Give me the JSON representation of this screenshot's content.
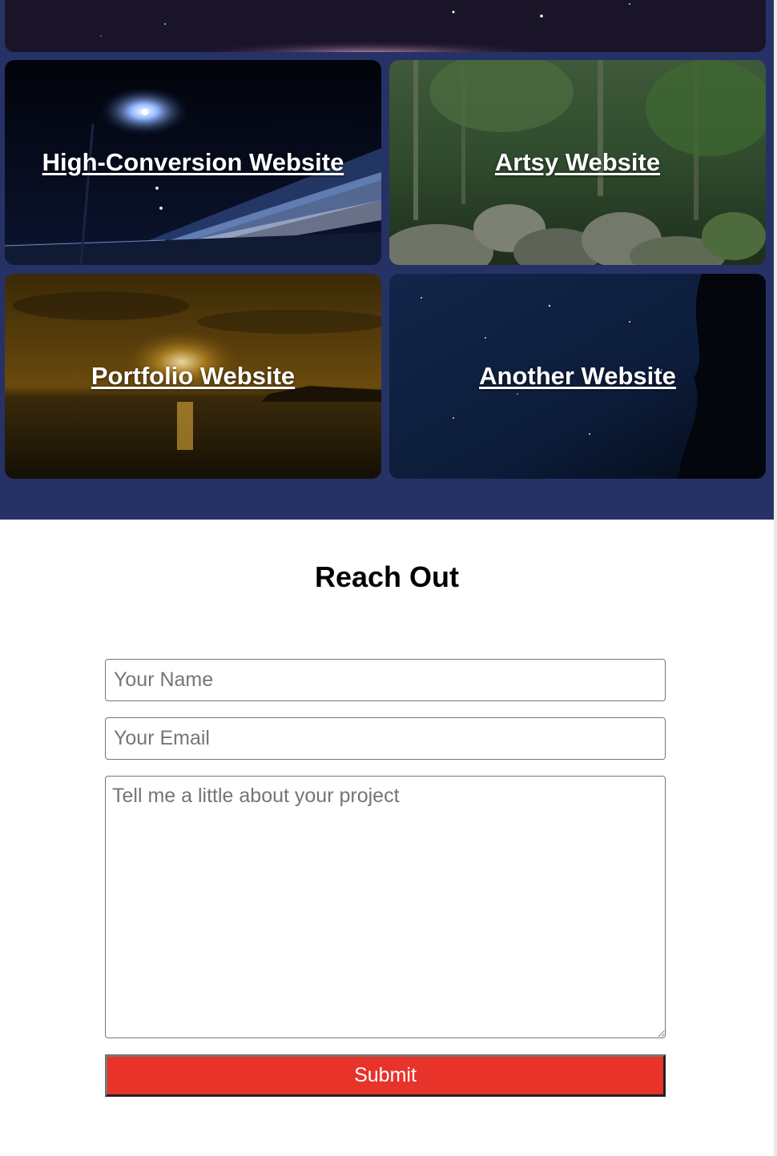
{
  "portfolio": {
    "tiles": [
      {
        "label": "High-Conversion Website"
      },
      {
        "label": "Artsy Website"
      },
      {
        "label": "Portfolio Website"
      },
      {
        "label": "Another Website"
      }
    ]
  },
  "contact": {
    "title": "Reach Out",
    "name_placeholder": "Your Name",
    "email_placeholder": "Your Email",
    "project_placeholder": "Tell me a little about your project",
    "submit_label": "Submit"
  },
  "colors": {
    "section_bg": "#263266",
    "submit_bg": "#e8332a"
  }
}
